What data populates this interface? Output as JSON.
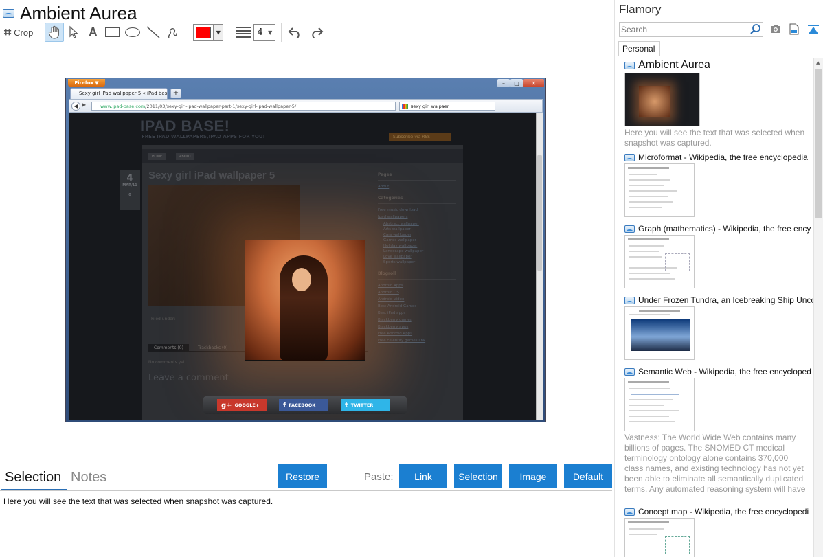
{
  "window": {
    "title": "Ambient Aurea"
  },
  "toolbar": {
    "crop_label": "Crop",
    "tools": [
      "hand-tool",
      "pointer-tool",
      "text-tool",
      "rectangle-tool",
      "ellipse-tool",
      "line-tool",
      "freehand-tool"
    ],
    "color": "#ff0000",
    "line_width": "4"
  },
  "snapshot": {
    "browser_menu": "Firefox",
    "tab_title": "Sexy girl iPad wallpaper 5 « iPad base!",
    "url_host": "www.ipad-base.com",
    "url_path": "/2011/03/sexy-girl-ipad-wallpaper-part-1/sexy-girl-ipad-wallpaper-5/",
    "search_query": "sexy girl walpaer",
    "site_title": "IPAD BASE!",
    "site_subtitle": "FREE IPAD WALLPAPERS,IPAD APPS FOR YOU!",
    "subscribe": "Subscribe via RSS",
    "nav": [
      "HOME",
      "ABOUT"
    ],
    "date_day": "4",
    "date_month": "MAR/11",
    "date_count": "0",
    "post_title": "Sexy girl iPad wallpaper 5",
    "filed_under": "Filed under:",
    "post_tabs": [
      "Comments (0)",
      "Trackbacks (0)"
    ],
    "no_comments": "No comments yet.",
    "leave_comment": "Leave a comment",
    "sidebar": {
      "pages_head": "Pages",
      "pages": [
        "About"
      ],
      "categories_head": "Categories",
      "categories": [
        "Free music download",
        "Ipad wallpapers"
      ],
      "subcategories": [
        "Abstract wallpaper",
        "Arts wallpaper",
        "Cars wallpaper",
        "Games wallpaper",
        "Holiday wallpaper",
        "Landscape wallpaper",
        "Love wallpaper",
        "Sports wallpaper"
      ],
      "blogroll_head": "Blogroll",
      "blogroll": [
        "Android Apps",
        "Android OS",
        "Android Video",
        "Best Android Games",
        "Best iPad apps",
        "Blackberry games",
        "Blackberry apps",
        "Free Android Apps",
        "Free celebrity games link"
      ]
    },
    "share": [
      {
        "icon": "g+",
        "label": "GOOGLE+"
      },
      {
        "icon": "f",
        "label": "FACEBOOK"
      },
      {
        "icon": "t",
        "label": "TWITTER"
      }
    ]
  },
  "bottom": {
    "tab_selection": "Selection",
    "tab_notes": "Notes",
    "restore": "Restore",
    "paste_label": "Paste:",
    "paste_buttons": {
      "link": "Link",
      "selection": "Selection",
      "image": "Image",
      "default": "Default"
    },
    "selection_text": "Here you will see the text that was selected when snapshot was captured."
  },
  "flamory": {
    "title": "Flamory",
    "search_placeholder": "Search",
    "tab": "Personal",
    "items": [
      {
        "title": "Ambient Aurea",
        "desc": "Here you will see the text that was selected when snapshot was captured."
      },
      {
        "title": "Microformat - Wikipedia, the free encyclopedia",
        "desc": ""
      },
      {
        "title": "Graph (mathematics) - Wikipedia, the free ency",
        "desc": ""
      },
      {
        "title": "Under Frozen Tundra, an Icebreaking Ship Unco",
        "desc": ""
      },
      {
        "title": "Semantic Web - Wikipedia, the free encycloped",
        "desc": "Vastness: The World Wide Web contains many billions of pages. The SNOMED CT medical terminology ontology alone contains 370,000 class names, and existing technology has not yet been able to eliminate all semantically duplicated terms. Any automated reasoning system will have to deal with truly huge inputs."
      },
      {
        "title": "Concept map - Wikipedia, the free encyclopedi",
        "desc": ""
      }
    ]
  },
  "colors": {
    "accent": "#1b7fd1",
    "selected_tab_underline": "#2b6fb5"
  }
}
